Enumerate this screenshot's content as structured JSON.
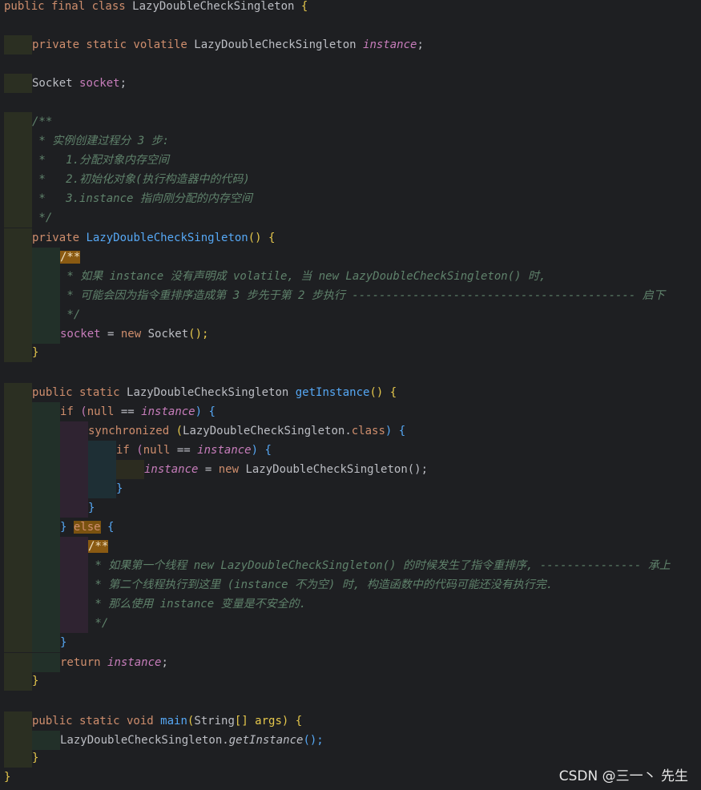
{
  "code_lines": [
    {
      "kw1": "public final class ",
      "name": "LazyDoubleCheckSingleton",
      "tail": " {"
    },
    {
      "kw": "private static volatile ",
      "type": "LazyDoubleCheckSingleton ",
      "field": "instance",
      "end": ";"
    },
    {
      "type": "Socket ",
      "field": "socket",
      "end": ";"
    },
    {
      "c0": "/**"
    },
    {
      "c1": " * 实例创建过程分 3 步:"
    },
    {
      "c2": " *   1.分配对象内存空间"
    },
    {
      "c3": " *   2.初始化对象(执行构造器中的代码)"
    },
    {
      "c4": " *   3.instance 指向刚分配的内存空间"
    },
    {
      "c5": " */"
    },
    {
      "kw": "private ",
      "ctor": "LazyDoubleCheckSingleton",
      "paren": "() {"
    },
    {
      "c0": "/**"
    },
    {
      "c1": " * 如果 instance 没有声明成 volatile, 当 new LazyDoubleCheckSingleton() 时,"
    },
    {
      "c2": " * 可能会因为指令重排序造成第 3 步先于第 2 步执行 ------------------------------------------ 启下"
    },
    {
      "c3": " */"
    },
    {
      "field": "socket",
      "op": " = ",
      "kw": "new ",
      "type": "Socket",
      "end": "();"
    },
    {
      "end": "}"
    },
    {
      "kw": "public static ",
      "type": "LazyDoubleCheckSingleton ",
      "fn": "getInstance",
      "end": "() {"
    },
    {
      "kw": "if ",
      "p1": "(",
      "kw2": "null",
      "op": " == ",
      "field": "instance",
      "p2": ") {"
    },
    {
      "kw": "synchronized ",
      "p1": "(",
      "type": "LazyDoubleCheckSingleton",
      "dot": ".",
      "kw2": "class",
      "p2": ") {"
    },
    {
      "kw": "if ",
      "p1": "(",
      "kw2": "null",
      "op": " == ",
      "field": "instance",
      "p2": ") {"
    },
    {
      "field": "instance",
      "op": " = ",
      "kw": "new ",
      "type": "LazyDoubleCheckSingleton",
      "end": "();"
    },
    {
      "end": "}"
    },
    {
      "end": "}"
    },
    {
      "p": "} ",
      "kw": "else",
      "end": " {"
    },
    {
      "c0": "/**"
    },
    {
      "c1": " * 如果第一个线程 new LazyDoubleCheckSingleton() 的时候发生了指令重排序, --------------- 承上"
    },
    {
      "c2": " * 第二个线程执行到这里 (instance 不为空) 时, 构造函数中的代码可能还没有执行完."
    },
    {
      "c3": " * 那么使用 instance 变量是不安全的."
    },
    {
      "c4": " */"
    },
    {
      "end": "}"
    },
    {
      "kw": "return ",
      "field": "instance",
      "end": ";"
    },
    {
      "end": "}"
    },
    {
      "kw": "public static void ",
      "fn": "main",
      "p": "(",
      "type": "String",
      "rest": "[] args) {"
    },
    {
      "type": "LazyDoubleCheckSingleton",
      "dot": ".",
      "call": "getInstance",
      "end": "();"
    },
    {
      "end": "}"
    },
    {
      "end": "}"
    }
  ],
  "watermark": "CSDN @三一丶 先生",
  "colors": {
    "background": "#1e1f22",
    "keyword": "#cf8e6d",
    "field": "#c77dbb",
    "comment": "#5f826b",
    "function": "#56a8f5",
    "text": "#bcbec4"
  }
}
